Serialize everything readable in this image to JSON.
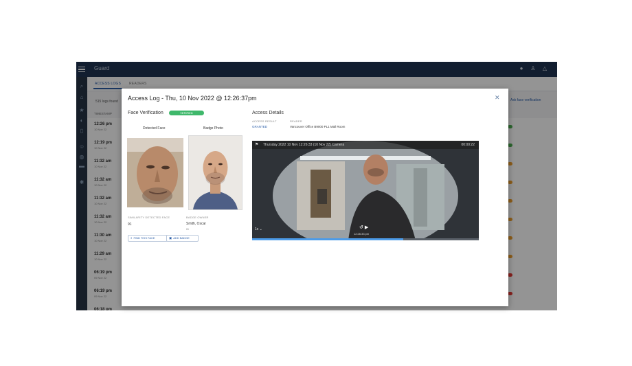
{
  "app": {
    "title": "Guard",
    "tabs": [
      "ACCESS LOGS",
      "READERS"
    ],
    "logs_found": "515 logs found",
    "right_link": "Ask face verification",
    "column_header": "TIMESTAMP",
    "rows": [
      {
        "time": "12:26 pm",
        "date": "10 Nov 22",
        "status_color": "#4caf50"
      },
      {
        "time": "12:19 pm",
        "date": "10 Nov 22",
        "status_color": "#4caf50"
      },
      {
        "time": "11:32 am",
        "date": "10 Nov 22",
        "status_color": "#f0a030"
      },
      {
        "time": "11:32 am",
        "date": "10 Nov 22",
        "status_color": "#f0a030"
      },
      {
        "time": "11:32 am",
        "date": "10 Nov 22",
        "status_color": "#f0a030"
      },
      {
        "time": "11:32 am",
        "date": "10 Nov 22",
        "status_color": "#f0a030"
      },
      {
        "time": "11:30 am",
        "date": "10 Nov 22",
        "status_color": "#f0a030"
      },
      {
        "time": "11:29 am",
        "date": "10 Nov 22",
        "status_color": "#f0a030"
      },
      {
        "time": "06:19 pm",
        "date": "09 Nov 22",
        "status_color": "#e53935"
      },
      {
        "time": "06:19 pm",
        "date": "09 Nov 22",
        "status_color": "#e53935"
      },
      {
        "time": "06:18 pm",
        "date": "09 Nov 22",
        "status_color": "#e53935"
      }
    ]
  },
  "modal": {
    "title": "Access Log - Thu, 10 Nov 2022 @ 12:26:37pm",
    "face_verification": {
      "heading": "Face Verification",
      "status": "VERIFIED",
      "detected_label": "Detected Face",
      "badge_label": "Badge Photo",
      "similarity_label": "SIMILARITY DETECTED FACE",
      "similarity_value": "91",
      "badge_owner_label": "BADGE OWNER",
      "badge_owner_name": "Smith, Oscar",
      "badge_owner_sub": "ID",
      "btn_find": "FIND THIS FACE",
      "btn_add": "ADD BADGE"
    },
    "access_details": {
      "heading": "Access Details",
      "access_result_label": "ACCESS RESULT",
      "access_result_value": "GRANTED",
      "reader_label": "READER",
      "reader_value": "Vancouver Office B9000 PL1 Mail Room"
    },
    "video": {
      "title": "Thursday 2022 10 Nov 12:26:33 (10 Nov 22) Camera",
      "right_text": "00:00:22",
      "speed": "1x",
      "time": "12:26:33 pm"
    }
  },
  "colors": {
    "topbar": "#1f3553",
    "accent": "#2b5ea8",
    "verified": "#3fb86b",
    "progress": "#4c9be8"
  }
}
